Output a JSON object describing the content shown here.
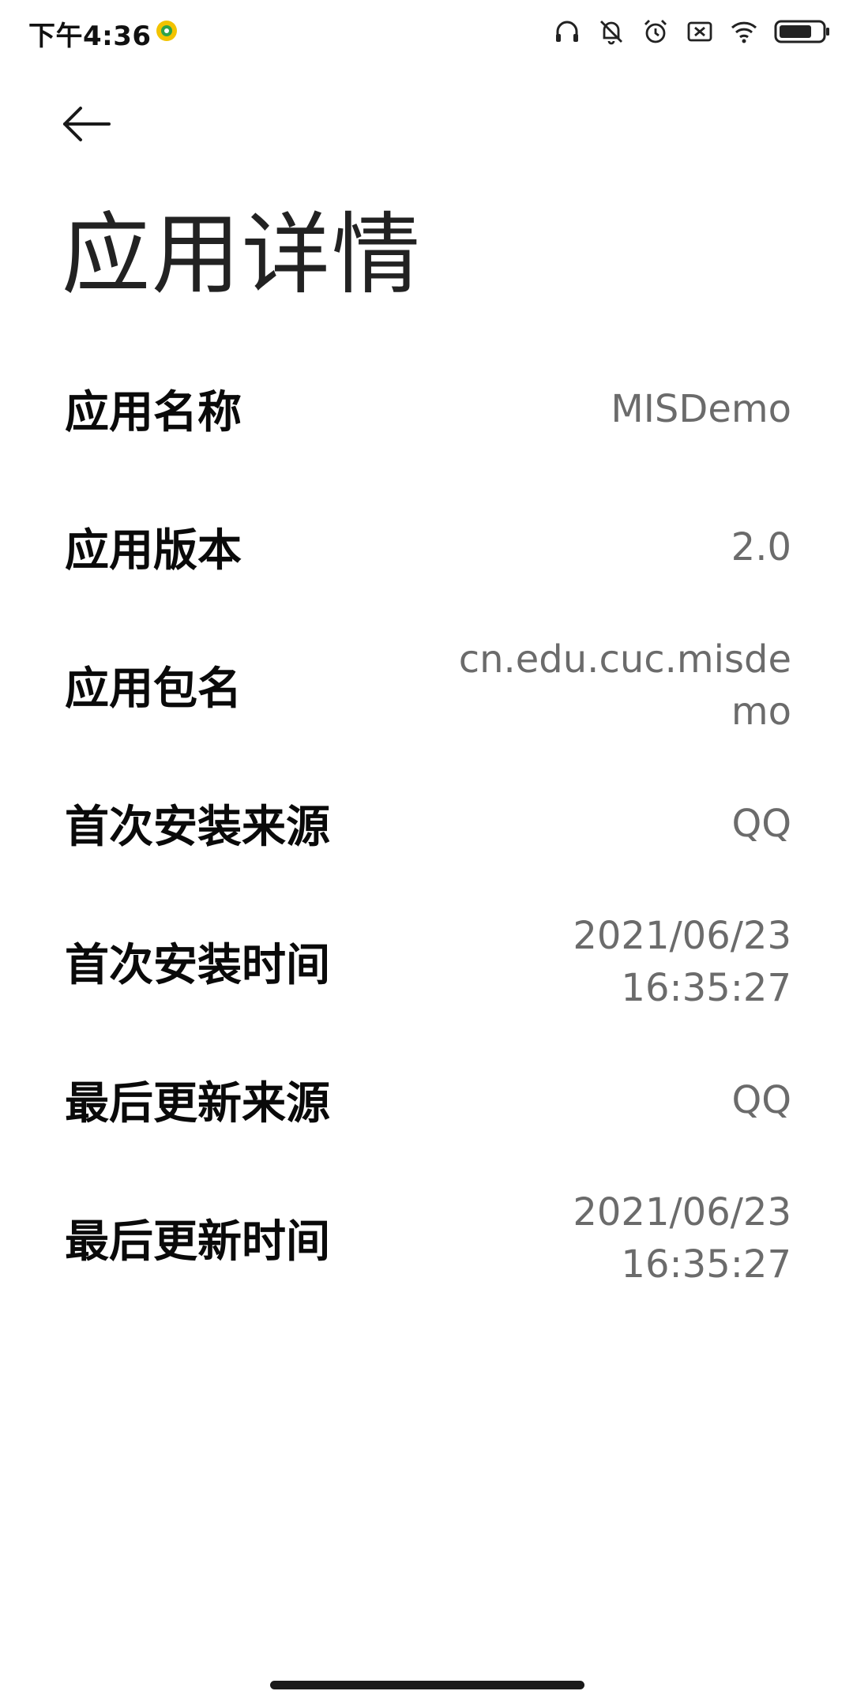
{
  "status_bar": {
    "time": "下午4:36",
    "icons": [
      "app-notification-icon",
      "headphones-icon",
      "bell-off-icon",
      "alarm-icon",
      "sim-off-icon",
      "wifi-icon",
      "battery-icon"
    ]
  },
  "header": {
    "back_icon": "arrow-left-icon",
    "title": "应用详情"
  },
  "details": {
    "rows": [
      {
        "label": "应用名称",
        "value_lines": [
          "MISDemo"
        ]
      },
      {
        "label": "应用版本",
        "value_lines": [
          "2.0"
        ]
      },
      {
        "label": "应用包名",
        "value_lines": [
          "cn.edu.cuc.misde",
          "mo"
        ]
      },
      {
        "label": "首次安装来源",
        "value_lines": [
          "QQ"
        ]
      },
      {
        "label": "首次安装时间",
        "value_lines": [
          "2021/06/23",
          "16:35:27"
        ]
      },
      {
        "label": "最后更新来源",
        "value_lines": [
          "QQ"
        ]
      },
      {
        "label": "最后更新时间",
        "value_lines": [
          "2021/06/23",
          "16:35:27"
        ]
      }
    ]
  },
  "colors": {
    "background": "#ffffff",
    "label": "#0a0a0a",
    "value": "#6b6b6b",
    "title": "#222222"
  }
}
